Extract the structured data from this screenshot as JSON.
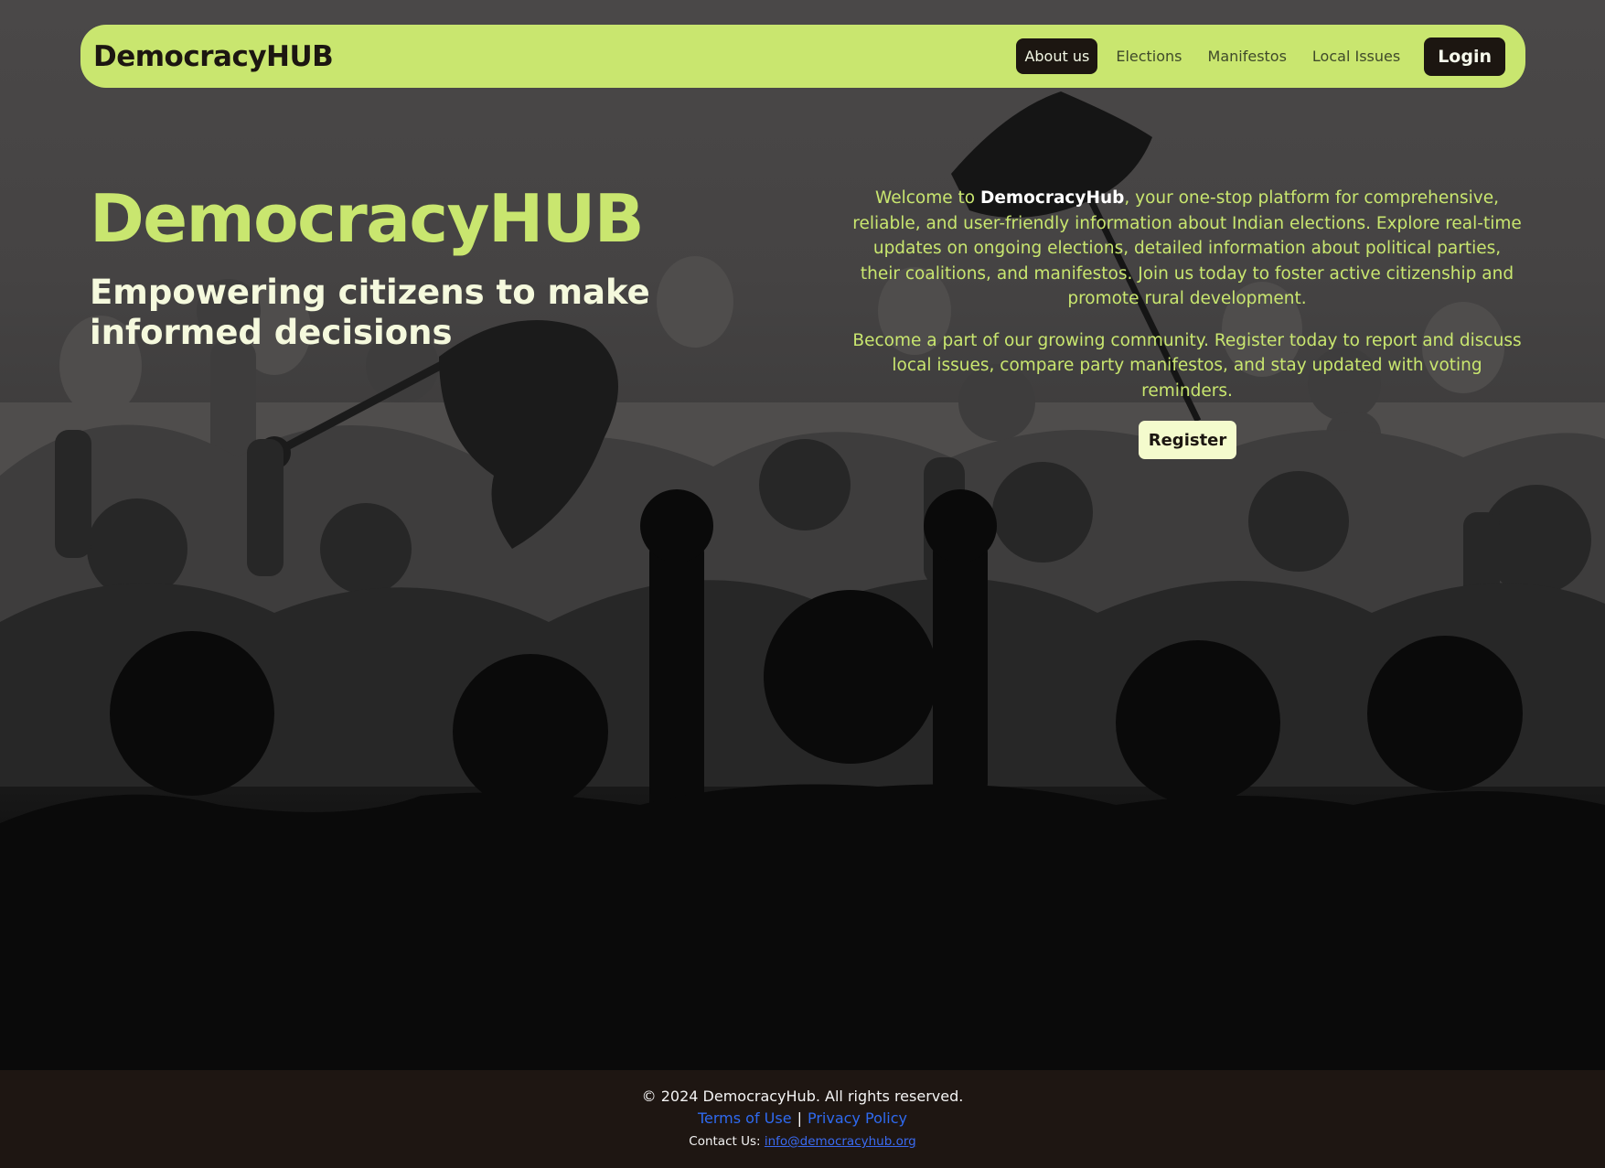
{
  "navbar": {
    "brand": "DemocracyHUB",
    "links": [
      {
        "label": "About us",
        "active": true
      },
      {
        "label": "Elections",
        "active": false
      },
      {
        "label": "Manifestos",
        "active": false
      },
      {
        "label": "Local Issues",
        "active": false
      }
    ],
    "login_label": "Login"
  },
  "hero": {
    "title": "DemocracyHUB",
    "subtitle": "Empowering citizens to make informed decisions",
    "intro": {
      "prefix": "Welcome to ",
      "highlight": "DemocracyHub",
      "rest": ", your one-stop platform for comprehensive, reliable, and user-friendly information about Indian elections. Explore real-time updates on ongoing elections, detailed information about political parties, their coalitions, and manifestos. Join us today to foster active citizenship and promote rural development."
    },
    "community_text": "Become a part of our growing community. Register today to report and discuss local issues, compare party manifestos, and stay updated with voting reminders.",
    "register_label": "Register"
  },
  "footer": {
    "copyright": "© 2024 DemocracyHub. All rights reserved.",
    "terms_label": "Terms of Use",
    "separator": "|",
    "privacy_label": "Privacy Policy",
    "contact_prefix": "Contact Us:",
    "contact_email": "info@democracyhub.org"
  },
  "colors": {
    "accent": "#c9e66f",
    "dark": "#1c1611",
    "footer_bg": "#1e1612",
    "link": "#2f6af0"
  }
}
